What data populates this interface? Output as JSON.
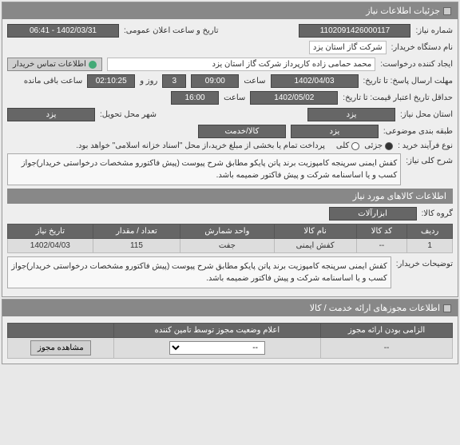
{
  "panel1": {
    "title": "جزئیات اطلاعات نیاز",
    "need_number_label": "شماره نیاز:",
    "need_number": "1102091426000117",
    "announce_label": "تاریخ و ساعت اعلان عمومی:",
    "announce_value": "1402/03/31 - 06:41",
    "buyer_label": "نام دستگاه خریدار:",
    "buyer_value": "شرکت گاز استان یزد",
    "requester_label": "ایجاد کننده درخواست:",
    "requester_value": "محمد حمامی زاده کارپرداز شرکت گاز استان یزد",
    "contact_btn": "اطلاعات تماس خریدار",
    "deadline_label": "مهلت ارسال پاسخ: تا تاریخ:",
    "deadline_date": "1402/04/03",
    "time_label": "ساعت",
    "deadline_time": "09:00",
    "days_count": "3",
    "days_label": "روز و",
    "remaining_time": "02:10:25",
    "remaining_label": "ساعت باقی مانده",
    "validity_label": "حداقل تاریخ اعتبار قیمت: تا تاریخ:",
    "validity_date": "1402/05/02",
    "validity_time": "16:00",
    "delivery_city_label": "شهر محل تحویل:",
    "delivery_city": "یزد",
    "need_city_label": "استان محل نیاز:",
    "need_city": "یزد",
    "category_label": "طبقه بندی موضوعی:",
    "category": "کالا/خدمت",
    "category2": "یزد",
    "purchase_type_label": "نوع فرآیند خرید :",
    "opt_partial": "جزئی",
    "opt_full": "کلی",
    "payment_note": "پرداخت تمام یا بخشی از مبلغ خرید،از محل \"اسناد خزانه اسلامی\" خواهد بود.",
    "desc_label": "شرح کلی نیاز:",
    "desc_text": "کفش ایمنی سرپنجه کامپوزیت برند پاتن پایکو مطابق شرح پیوست (پیش فاکتورو مشخصات درخواستی خریدار)جواز کسب و یا اساسنامه شرکت و پیش فاکتور ضمیمه باشد."
  },
  "goods": {
    "header": "اطلاعات کالاهای مورد نیاز",
    "group_label": "گروه کالا:",
    "group_value": "ابزارآلات",
    "columns": [
      "ردیف",
      "کد کالا",
      "نام کالا",
      "واحد شمارش",
      "تعداد / مقدار",
      "تاریخ نیاز"
    ],
    "rows": [
      {
        "idx": "1",
        "code": "--",
        "name": "کفش ایمنی",
        "unit": "جفت",
        "qty": "115",
        "date": "1402/04/03"
      }
    ],
    "buyer_note_label": "توضیحات خریدار:",
    "buyer_note": "کفش ایمنی سرپنجه کامپوزیت برند پاتن پایکو مطابق شرح پیوست (پیش فاکتورو مشخصات درخواستی خریدار)جواز کسب و یا اساسنامه شرکت و پیش فاکتور ضمیمه باشد."
  },
  "permits": {
    "header": "اطلاعات مجوزهای ارائه خدمت / کالا",
    "columns": [
      "الزامی بودن ارائه مجوز",
      "اعلام وضعیت مجوز توسط تامین کننده",
      ""
    ],
    "row": {
      "required": "--",
      "select_placeholder": "--",
      "view_btn": "مشاهده مجوز"
    }
  }
}
